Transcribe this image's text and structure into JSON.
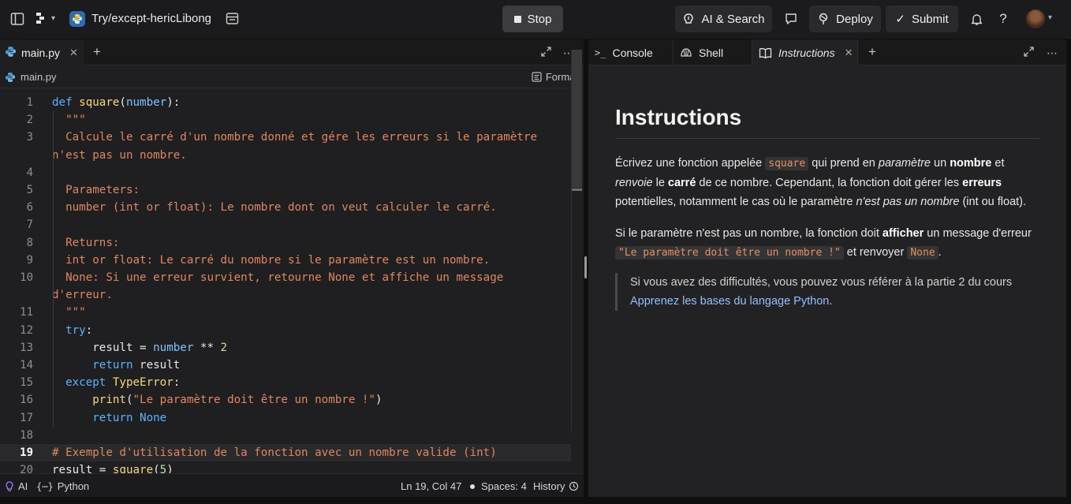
{
  "topbar": {
    "repl_name": "Try/except-hericLibong",
    "stop_label": "Stop",
    "ai_search_label": "AI & Search",
    "deploy_label": "Deploy",
    "submit_label": "Submit"
  },
  "editor": {
    "tab_label": "main.py",
    "breadcrumb": "main.py",
    "format_label": "Format",
    "current_line": 19
  },
  "status": {
    "ai_label": "AI",
    "language": "Python",
    "cursor": "Ln 19, Col 47",
    "spaces": "Spaces: 4",
    "history": "History"
  },
  "right_tabs": [
    "Console",
    "Shell",
    "Instructions"
  ],
  "instructions": {
    "title": "Instructions",
    "p1": {
      "t1": "Écrivez une fonction appelée ",
      "code1": "square",
      "t2": " qui prend en ",
      "i1": "paramètre",
      "t3": " un ",
      "b1": "nombre",
      "t4": " et ",
      "i2": "renvoie",
      "t5": " le ",
      "b2": "carré",
      "t6": " de ce nombre. Cependant, la fonction doit gérer les ",
      "b3": "erreurs",
      "t7": " potentielles, notamment le cas où le paramètre ",
      "i3": "n'est pas un nombre",
      "t8": " (int ou float)."
    },
    "p2": {
      "t1": "Si le paramètre n'est pas un nombre, la fonction doit ",
      "b1": "afficher",
      "t2": " un message d'erreur ",
      "code1": "\"Le paramètre doit être un nombre !\"",
      "t3": " et renvoyer ",
      "code2": "None",
      "t4": "."
    },
    "quote": {
      "t1": "Si vous avez des difficultés, vous pouvez vous référer à la partie 2 du cours",
      "link": "Apprenez les bases du langage Python",
      "t2": "."
    }
  },
  "code_lines": [
    {
      "n": "1",
      "text": "def square(number):"
    },
    {
      "n": "2",
      "text": "  \"\"\""
    },
    {
      "n": "3",
      "text": "  Calcule le carré d'un nombre donné et gére les erreurs si le paramètre"
    },
    {
      "n": "",
      "text": "n'est pas un nombre."
    },
    {
      "n": "4",
      "text": ""
    },
    {
      "n": "5",
      "text": "  Parameters:"
    },
    {
      "n": "6",
      "text": "  number (int or float): Le nombre dont on veut calculer le carré."
    },
    {
      "n": "7",
      "text": ""
    },
    {
      "n": "8",
      "text": "  Returns:"
    },
    {
      "n": "9",
      "text": "  int or float: Le carré du nombre si le paramètre est un nombre."
    },
    {
      "n": "10",
      "text": "  None: Si une erreur survient, retourne None et affiche un message"
    },
    {
      "n": "",
      "text": "d'erreur."
    },
    {
      "n": "11",
      "text": "  \"\"\""
    },
    {
      "n": "12",
      "text": "  try:"
    },
    {
      "n": "13",
      "text": "      result = number ** 2"
    },
    {
      "n": "14",
      "text": "      return result"
    },
    {
      "n": "15",
      "text": "  except TypeError:"
    },
    {
      "n": "16",
      "text": "      print(\"Le paramètre doit être un nombre !\")"
    },
    {
      "n": "17",
      "text": "      return None"
    },
    {
      "n": "18",
      "text": ""
    },
    {
      "n": "19",
      "text": "# Exemple d'utilisation de la fonction avec un nombre valide (int)"
    },
    {
      "n": "20",
      "text": "result = square(5)"
    }
  ]
}
